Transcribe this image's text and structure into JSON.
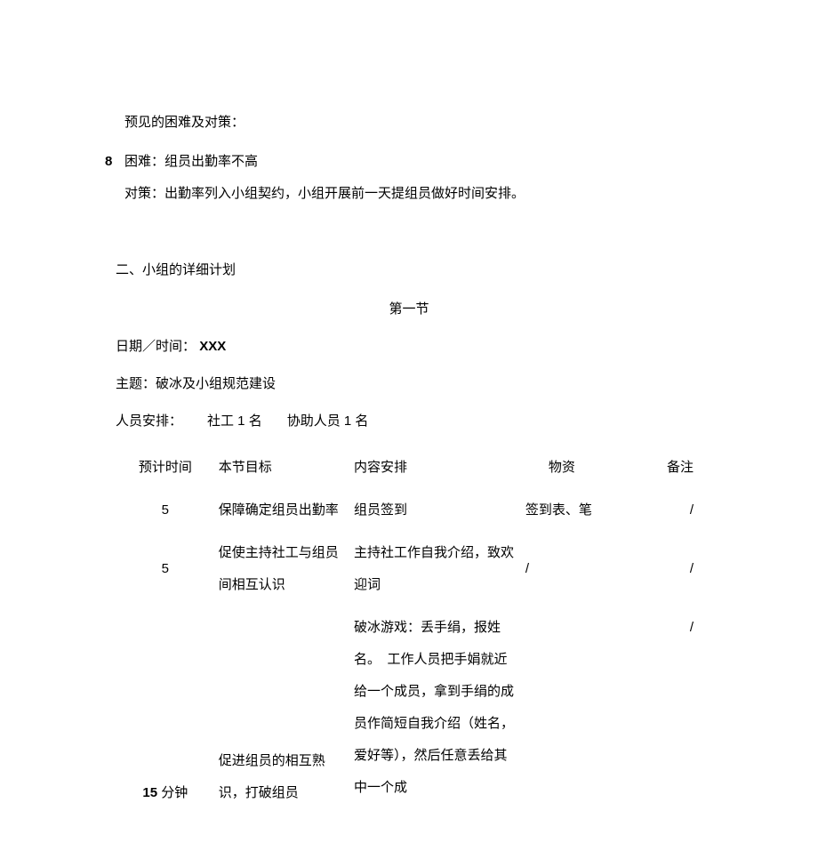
{
  "intro": {
    "heading": "预见的困难及对策：",
    "bullet_num": "8",
    "difficulty": "困难：组员出勤率不高",
    "strategy": "对策：出勤率列入小组契约，小组开展前一天提组员做好时间安排。"
  },
  "section2": {
    "title": "二、小组的详细计划",
    "subheading": "第一节",
    "date_label": "日期／时间：",
    "date_value": "XXX",
    "topic_label": "主题：",
    "topic_value": "破冰及小组规范建设",
    "staff_label": "人员安排：",
    "staff_value1": "社工 1 名",
    "staff_value2": "协助人员 1 名"
  },
  "table": {
    "headers": {
      "time": "预计时间",
      "goal": "本节目标",
      "content": "内容安排",
      "resources": "物资",
      "note": "备注"
    },
    "rows": [
      {
        "time": "5",
        "goal": "保障确定组员出勤率",
        "content": "组员签到",
        "resources": "签到表、笔",
        "note": "/"
      },
      {
        "time": "5",
        "goal": "促使主持社工与组员间相互认识",
        "content": "主持社工作自我介绍，致欢迎词",
        "resources": "/",
        "note": "/"
      },
      {
        "time": "15 分钟",
        "goal": "促进组员的相互熟识，打破组员",
        "content": "破冰游戏：丢手绢，报姓名。　工作人员把手娟就近给一个成员，拿到手绢的成员作简短自我介绍（姓名，爱好等），然后任意丢给其中一个成",
        "resources": "",
        "note": "/"
      }
    ]
  }
}
